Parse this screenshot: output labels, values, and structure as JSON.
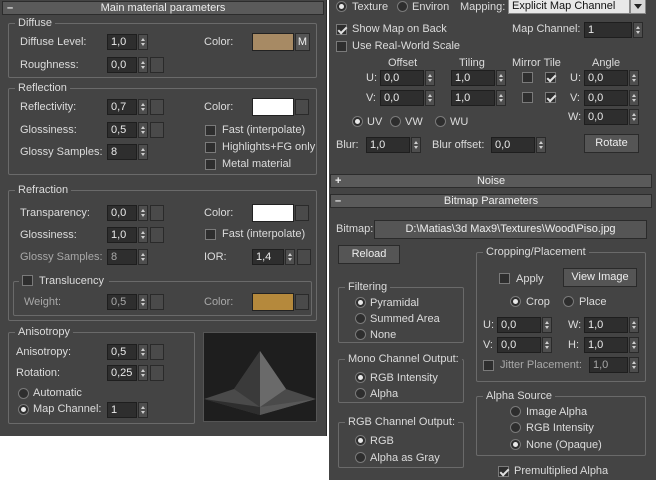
{
  "main": {
    "title": "Main material parameters",
    "diffuse": {
      "title": "Diffuse",
      "level_label": "Diffuse Level:",
      "level": "1,0",
      "roughness_label": "Roughness:",
      "roughness": "0,0",
      "color_label": "Color:",
      "color": "#a78a64",
      "map_letter": "M"
    },
    "reflection": {
      "title": "Reflection",
      "reflectivity_label": "Reflectivity:",
      "reflectivity": "0,7",
      "glossiness_label": "Glossiness:",
      "glossiness": "0,5",
      "samples_label": "Glossy Samples:",
      "samples": "8",
      "color_label": "Color:",
      "color": "#ffffff",
      "fast_label": "Fast (interpolate)",
      "highlights_label": "Highlights+FG only",
      "metal_label": "Metal material"
    },
    "refraction": {
      "title": "Refraction",
      "transparency_label": "Transparency:",
      "transparency": "0,0",
      "glossiness_label": "Glossiness:",
      "glossiness": "1,0",
      "samples_label": "Glossy Samples:",
      "samples": "8",
      "color_label": "Color:",
      "color": "#ffffff",
      "fast_label": "Fast (interpolate)",
      "ior_label": "IOR:",
      "ior": "1,4",
      "translucency_label": "Translucency",
      "weight_label": "Weight:",
      "weight": "0,5",
      "trans_color_label": "Color:",
      "trans_color": "#b5893c"
    },
    "anisotropy": {
      "title": "Anisotropy",
      "anisotropy_label": "Anisotropy:",
      "anisotropy": "0,5",
      "rotation_label": "Rotation:",
      "rotation": "0,25",
      "automatic_label": "Automatic",
      "map_channel_label": "Map Channel:",
      "map_channel": "1"
    }
  },
  "coords": {
    "texture_label": "Texture",
    "environ_label": "Environ",
    "mapping_label": "Mapping:",
    "mapping_value": "Explicit Map Channel",
    "show_map_label": "Show Map on Back",
    "real_world_label": "Use Real-World Scale",
    "map_channel_label": "Map Channel:",
    "map_channel": "1",
    "offset_label": "Offset",
    "tiling_label": "Tiling",
    "mirror_tile_label": "Mirror Tile",
    "angle_label": "Angle",
    "u_label": "U:",
    "v_label": "V:",
    "w_label": "W:",
    "u_offset": "0,0",
    "v_offset": "0,0",
    "u_tiling": "1,0",
    "v_tiling": "1,0",
    "u_angle": "0,0",
    "v_angle": "0,0",
    "w_angle": "0,0",
    "uv_label": "UV",
    "vw_label": "VW",
    "wu_label": "WU",
    "blur_label": "Blur:",
    "blur": "1,0",
    "blur_offset_label": "Blur offset:",
    "blur_offset": "0,0",
    "rotate_label": "Rotate"
  },
  "noise": {
    "title": "Noise"
  },
  "bitmap": {
    "title": "Bitmap Parameters",
    "bitmap_label": "Bitmap:",
    "path": "D:\\Matias\\3d Max9\\Textures\\Wood\\Piso.jpg",
    "reload_label": "Reload",
    "cropping": {
      "title": "Cropping/Placement",
      "apply_label": "Apply",
      "view_image_label": "View Image",
      "crop_label": "Crop",
      "place_label": "Place",
      "u_label": "U:",
      "u": "0,0",
      "w_label": "W:",
      "w": "1,0",
      "v_label": "V:",
      "v": "0,0",
      "h_label": "H:",
      "h": "1,0",
      "jitter_label": "Jitter Placement:",
      "jitter": "1,0"
    },
    "filtering": {
      "title": "Filtering",
      "pyramidal_label": "Pyramidal",
      "summed_label": "Summed Area",
      "none_label": "None"
    },
    "mono": {
      "title": "Mono Channel Output:",
      "rgb_intensity_label": "RGB Intensity",
      "alpha_label": "Alpha"
    },
    "rgb": {
      "title": "RGB Channel Output:",
      "rgb_label": "RGB",
      "alpha_gray_label": "Alpha as Gray"
    },
    "alpha_source": {
      "title": "Alpha Source",
      "image_alpha_label": "Image Alpha",
      "rgb_intensity_label": "RGB Intensity",
      "none_opaque_label": "None (Opaque)"
    },
    "premultiplied_label": "Premultiplied Alpha"
  }
}
